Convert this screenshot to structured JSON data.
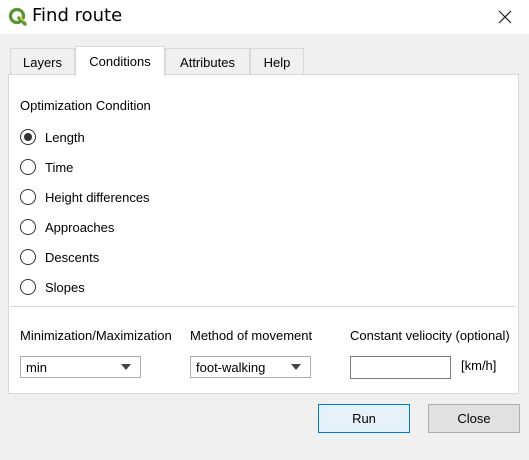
{
  "window": {
    "title": "Find route"
  },
  "tabs": [
    {
      "label": "Layers"
    },
    {
      "label": "Conditions"
    },
    {
      "label": "Attributes"
    },
    {
      "label": "Help"
    }
  ],
  "active_tab": "Conditions",
  "optimization": {
    "title": "Optimization Condition",
    "options": [
      {
        "label": "Length",
        "selected": true
      },
      {
        "label": "Time",
        "selected": false
      },
      {
        "label": "Height differences",
        "selected": false
      },
      {
        "label": "Approaches",
        "selected": false
      },
      {
        "label": "Descents",
        "selected": false
      },
      {
        "label": "Slopes",
        "selected": false
      }
    ]
  },
  "minimization": {
    "label": "Minimization/Maximization",
    "value": "min"
  },
  "movement": {
    "label": "Method of movement",
    "value": "foot-walking"
  },
  "velocity": {
    "label": "Constant veliocity (optional)",
    "value": "",
    "unit": "[km/h]"
  },
  "buttons": {
    "run": "Run",
    "close": "Close"
  },
  "colors": {
    "accent": "#0078d7",
    "qgis_green": "#589632",
    "qgis_yellow": "#ee7913"
  },
  "icons": {
    "app": "qgis-logo-icon",
    "close": "close-icon",
    "dropdown": "chevron-down-icon"
  }
}
